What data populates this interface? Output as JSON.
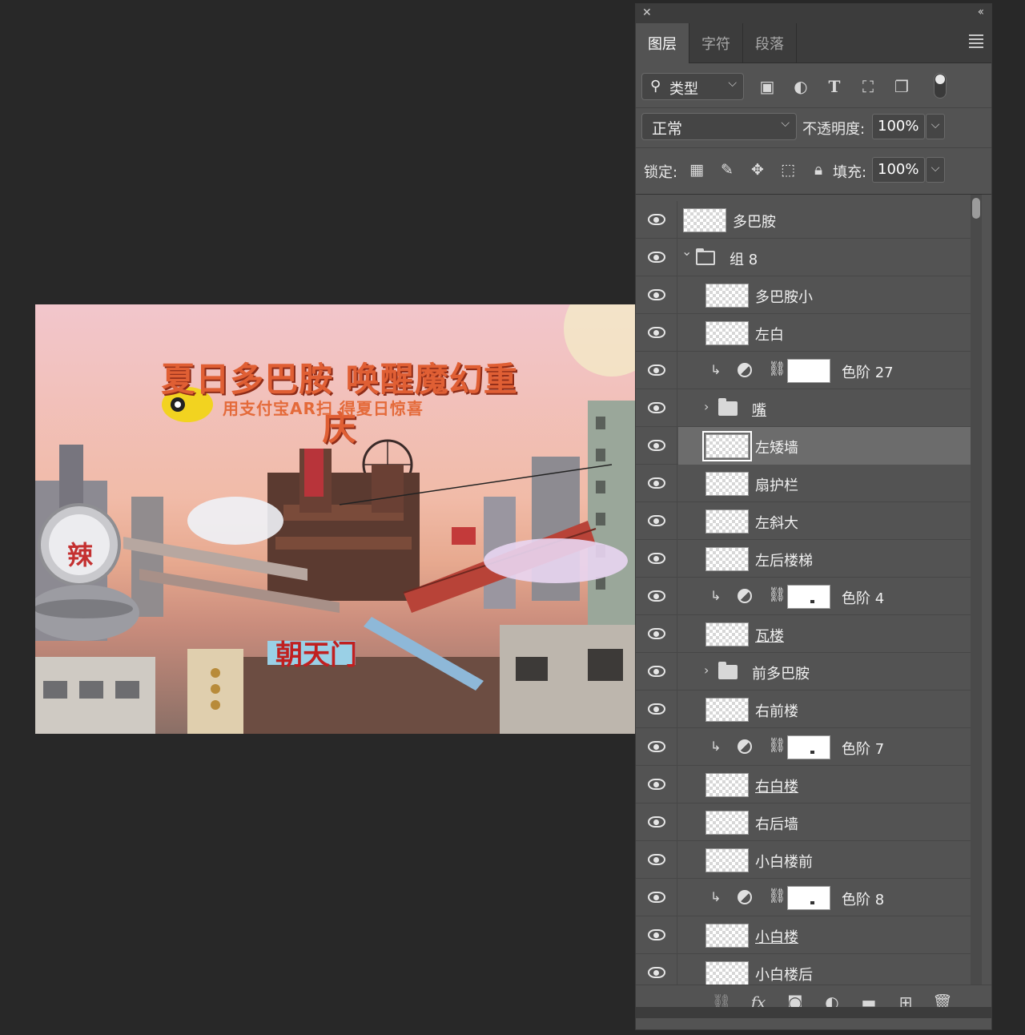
{
  "canvas": {
    "headline": "夏日多巴胺 唤醒魔幻重庆",
    "subline": "用支付宝AR扫   得夏日惊喜",
    "sign_text": "朝天门",
    "badge_text": "辣"
  },
  "panel": {
    "tabs": [
      {
        "label": "图层",
        "active": true
      },
      {
        "label": "字符",
        "active": false
      },
      {
        "label": "段落",
        "active": false
      }
    ],
    "filter": {
      "label": "类型"
    },
    "filter_icons": [
      "image-filter-icon",
      "adjustment-filter-icon",
      "type-filter-icon",
      "shape-filter-icon",
      "smart-object-filter-icon"
    ],
    "blend_mode": "正常",
    "opacity_label": "不透明度:",
    "opacity_value": "100%",
    "lock_label": "锁定:",
    "lock_icons": [
      "lock-transparent-icon",
      "lock-image-icon",
      "lock-position-icon",
      "lock-artboard-icon",
      "lock-all-icon"
    ],
    "fill_label": "填充:",
    "fill_value": "100%",
    "layers": [
      {
        "name": "多巴胺",
        "kind": "pixel",
        "indent": 0,
        "underline": false
      },
      {
        "name": "组 8",
        "kind": "group-open",
        "indent": 0,
        "underline": false
      },
      {
        "name": "多巴胺小",
        "kind": "pixel",
        "indent": 1,
        "underline": false
      },
      {
        "name": "左白",
        "kind": "pixel",
        "indent": 1,
        "underline": false
      },
      {
        "name": "色阶 27",
        "kind": "adjust",
        "indent": 1,
        "underline": false
      },
      {
        "name": "嘴",
        "kind": "group",
        "indent": 1,
        "underline": true
      },
      {
        "name": "左矮墙",
        "kind": "pixel",
        "indent": 1,
        "underline": false,
        "selected": true
      },
      {
        "name": "扇护栏",
        "kind": "pixel",
        "indent": 1,
        "underline": false
      },
      {
        "name": "左斜大",
        "kind": "pixel",
        "indent": 1,
        "underline": false
      },
      {
        "name": "左后楼梯",
        "kind": "pixel",
        "indent": 1,
        "underline": false
      },
      {
        "name": "色阶 4",
        "kind": "adjust",
        "indent": 1,
        "underline": false
      },
      {
        "name": "瓦楼",
        "kind": "pixel",
        "indent": 1,
        "underline": true
      },
      {
        "name": "前多巴胺",
        "kind": "group",
        "indent": 1,
        "underline": false
      },
      {
        "name": "右前楼",
        "kind": "pixel",
        "indent": 1,
        "underline": false
      },
      {
        "name": "色阶 7",
        "kind": "adjust",
        "indent": 1,
        "underline": false
      },
      {
        "name": "右白楼",
        "kind": "pixel",
        "indent": 1,
        "underline": true
      },
      {
        "name": "右后墙",
        "kind": "pixel",
        "indent": 1,
        "underline": false
      },
      {
        "name": "小白楼前",
        "kind": "pixel",
        "indent": 1,
        "underline": false
      },
      {
        "name": "色阶 8",
        "kind": "adjust",
        "indent": 1,
        "underline": false
      },
      {
        "name": "小白楼",
        "kind": "pixel",
        "indent": 1,
        "underline": true
      },
      {
        "name": "小白楼后",
        "kind": "pixel",
        "indent": 1,
        "underline": false
      }
    ],
    "bottom_icons": [
      "link-layers-icon",
      "fx-icon",
      "add-mask-icon",
      "new-adjustment-icon",
      "new-group-icon",
      "new-layer-icon",
      "delete-layer-icon"
    ]
  }
}
